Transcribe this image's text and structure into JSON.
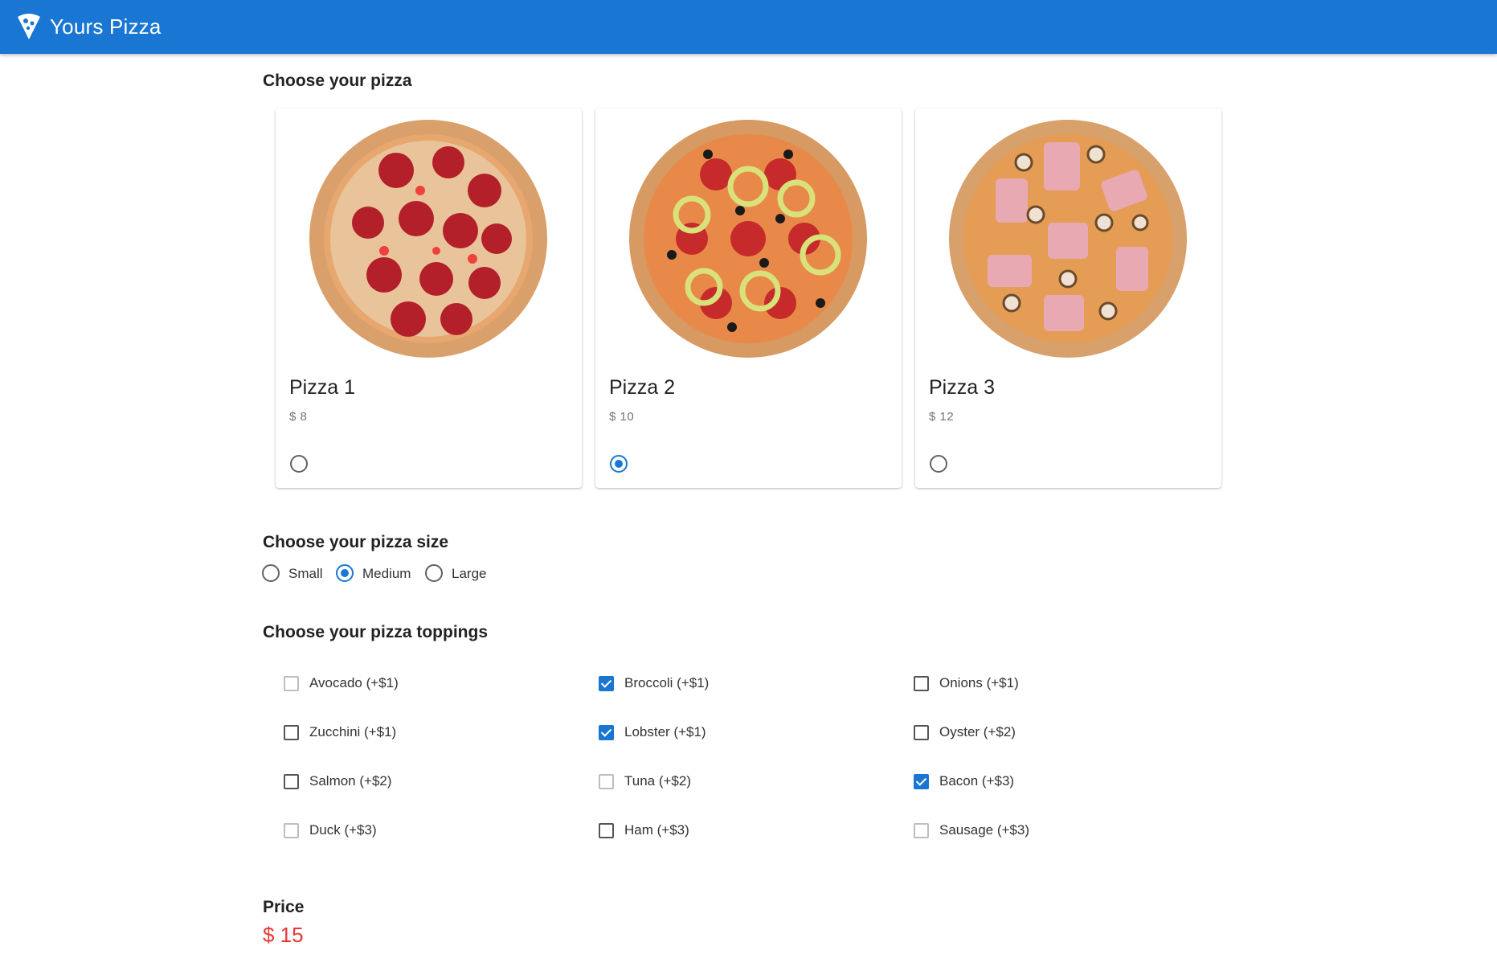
{
  "header": {
    "title": "Yours Pizza",
    "logo_icon": "pizza-slice-icon",
    "color": "#1976d2"
  },
  "pizza_section": {
    "title": "Choose your pizza",
    "pizzas": [
      {
        "name": "Pizza 1",
        "price": "$ 8",
        "selected": false
      },
      {
        "name": "Pizza 2",
        "price": "$ 10",
        "selected": true
      },
      {
        "name": "Pizza 3",
        "price": "$ 12",
        "selected": false
      }
    ]
  },
  "size_section": {
    "title": "Choose your pizza size",
    "options": [
      {
        "label": "Small",
        "selected": false
      },
      {
        "label": "Medium",
        "selected": true
      },
      {
        "label": "Large",
        "selected": false
      }
    ]
  },
  "toppings_section": {
    "title": "Choose your pizza toppings",
    "toppings": [
      {
        "label": "Avocado (+$1)",
        "checked": false
      },
      {
        "label": "Broccoli (+$1)",
        "checked": true
      },
      {
        "label": "Onions (+$1)",
        "checked": false
      },
      {
        "label": "Zucchini (+$1)",
        "checked": false
      },
      {
        "label": "Lobster (+$1)",
        "checked": true
      },
      {
        "label": "Oyster (+$2)",
        "checked": false
      },
      {
        "label": "Salmon (+$2)",
        "checked": false
      },
      {
        "label": "Tuna (+$2)",
        "checked": false
      },
      {
        "label": "Bacon (+$3)",
        "checked": true
      },
      {
        "label": "Duck (+$3)",
        "checked": false
      },
      {
        "label": "Ham (+$3)",
        "checked": false
      },
      {
        "label": "Sausage (+$3)",
        "checked": false
      }
    ]
  },
  "price": {
    "label": "Price",
    "value": "$ 15",
    "color": "#e53935"
  }
}
